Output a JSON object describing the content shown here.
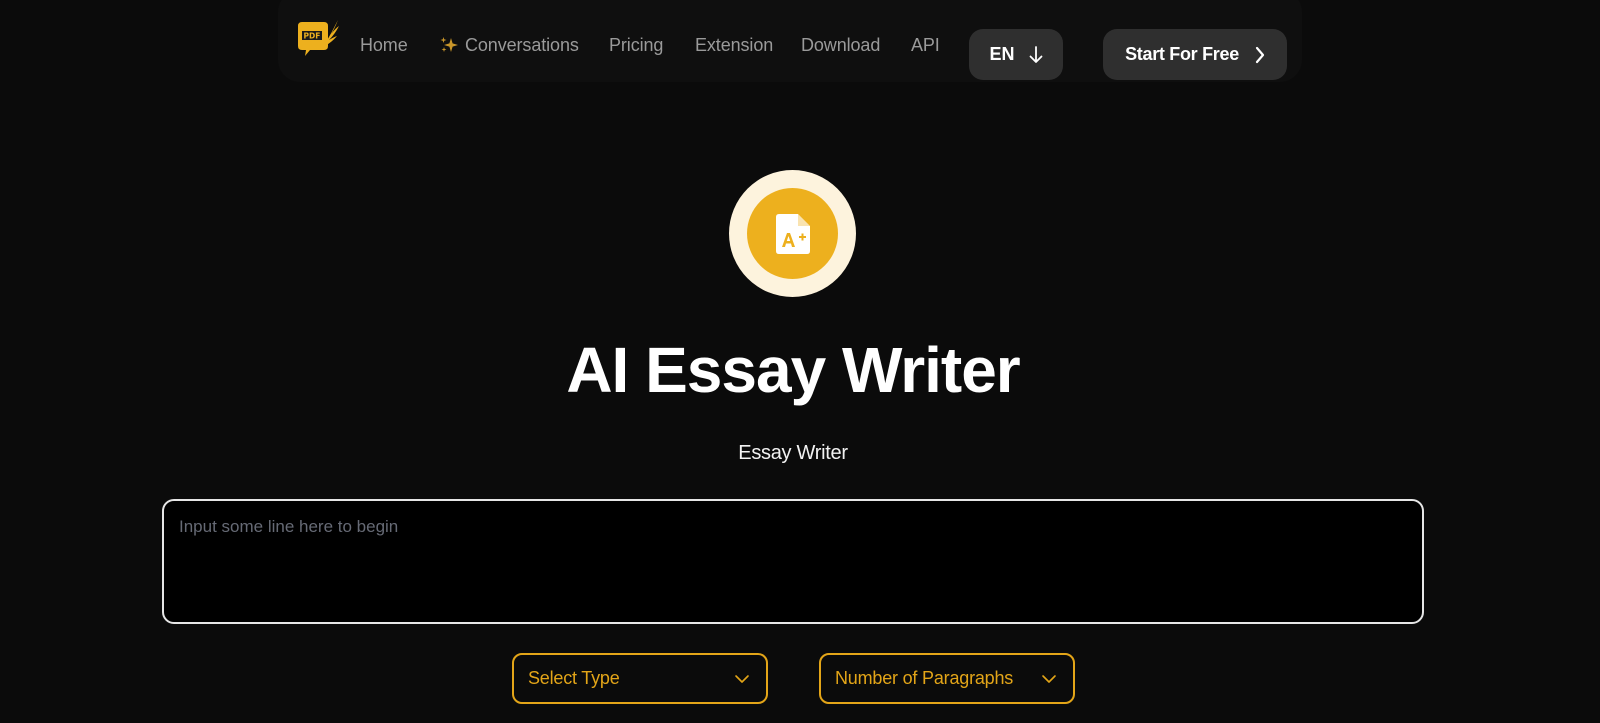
{
  "nav": {
    "logo_label": "PDF",
    "links": [
      {
        "label": "Home"
      },
      {
        "label": "Conversations",
        "icon": "sparkle-icon"
      },
      {
        "label": "Pricing"
      },
      {
        "label": "Extension"
      },
      {
        "label": "Download"
      },
      {
        "label": "API"
      }
    ],
    "language": {
      "label": "EN",
      "icon": "arrow-down-icon"
    },
    "cta": {
      "label": "Start For Free",
      "icon": "chevron-right-icon"
    }
  },
  "hero": {
    "icon": "document-a-plus-icon",
    "title": "AI Essay Writer",
    "subtitle": "Essay Writer"
  },
  "form": {
    "input": {
      "value": "",
      "placeholder": "Input some line here to begin"
    },
    "select_type": {
      "label": "Select Type",
      "icon": "chevron-down-icon"
    },
    "select_paragraphs": {
      "label": "Number of Paragraphs",
      "icon": "chevron-down-icon"
    }
  },
  "colors": {
    "background": "#0b0b0b",
    "accent": "#edb01e",
    "accent_light": "#fdf3dd",
    "button_bg": "#2f2f2f",
    "nav_text": "#9a9a9a"
  }
}
